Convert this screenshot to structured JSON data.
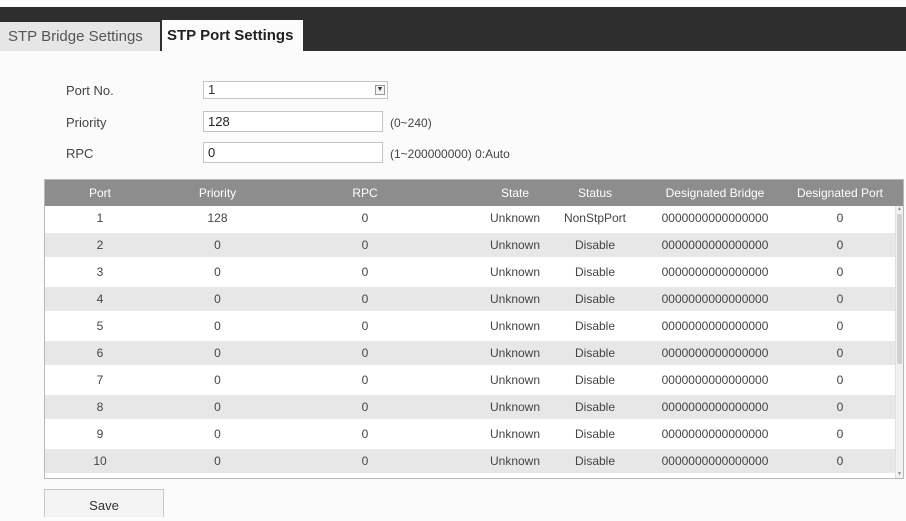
{
  "tabs": [
    {
      "label": "STP Bridge Settings"
    },
    {
      "label": "STP Port Settings"
    }
  ],
  "form": {
    "port_no": {
      "label": "Port No.",
      "value": "1"
    },
    "priority": {
      "label": "Priority",
      "value": "128",
      "hint": "(0~240)"
    },
    "rpc": {
      "label": "RPC",
      "value": "0",
      "hint": "(1~200000000) 0:Auto"
    }
  },
  "table": {
    "headers": [
      "Port",
      "Priority",
      "RPC",
      "State",
      "Status",
      "Designated Bridge",
      "Designated Port"
    ],
    "rows": [
      [
        "1",
        "128",
        "0",
        "Unknown",
        "NonStpPort",
        "0000000000000000",
        "0"
      ],
      [
        "2",
        "0",
        "0",
        "Unknown",
        "Disable",
        "0000000000000000",
        "0"
      ],
      [
        "3",
        "0",
        "0",
        "Unknown",
        "Disable",
        "0000000000000000",
        "0"
      ],
      [
        "4",
        "0",
        "0",
        "Unknown",
        "Disable",
        "0000000000000000",
        "0"
      ],
      [
        "5",
        "0",
        "0",
        "Unknown",
        "Disable",
        "0000000000000000",
        "0"
      ],
      [
        "6",
        "0",
        "0",
        "Unknown",
        "Disable",
        "0000000000000000",
        "0"
      ],
      [
        "7",
        "0",
        "0",
        "Unknown",
        "Disable",
        "0000000000000000",
        "0"
      ],
      [
        "8",
        "0",
        "0",
        "Unknown",
        "Disable",
        "0000000000000000",
        "0"
      ],
      [
        "9",
        "0",
        "0",
        "Unknown",
        "Disable",
        "0000000000000000",
        "0"
      ],
      [
        "10",
        "0",
        "0",
        "Unknown",
        "Disable",
        "0000000000000000",
        "0"
      ]
    ]
  },
  "save_label": "Save"
}
